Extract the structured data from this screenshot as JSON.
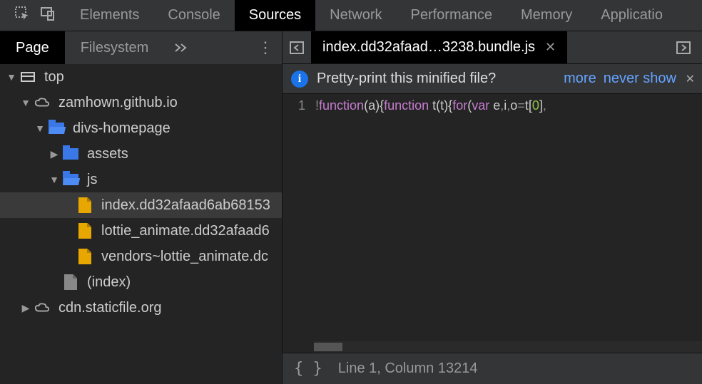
{
  "top_tabs": {
    "items": [
      "Elements",
      "Console",
      "Sources",
      "Network",
      "Performance",
      "Memory",
      "Applicatio"
    ],
    "active_index": 2
  },
  "nav_tabs": {
    "items": [
      "Page",
      "Filesystem"
    ],
    "active_index": 0
  },
  "editor_tab": {
    "label": "index.dd32afaad…3238.bundle.js"
  },
  "tree": {
    "root": "top",
    "domain1": "zamhown.github.io",
    "folder1": "divs-homepage",
    "assets": "assets",
    "js": "js",
    "files": [
      "index.dd32afaad6ab68153",
      "lottie_animate.dd32afaad6",
      "vendors~lottie_animate.dc"
    ],
    "index_file": "(index)",
    "domain2": "cdn.staticfile.org"
  },
  "infobar": {
    "message": "Pretty-print this minified file?",
    "more": "more",
    "never": "never show"
  },
  "code": {
    "line_no": "1"
  },
  "status": {
    "position": "Line 1, Column 13214"
  }
}
